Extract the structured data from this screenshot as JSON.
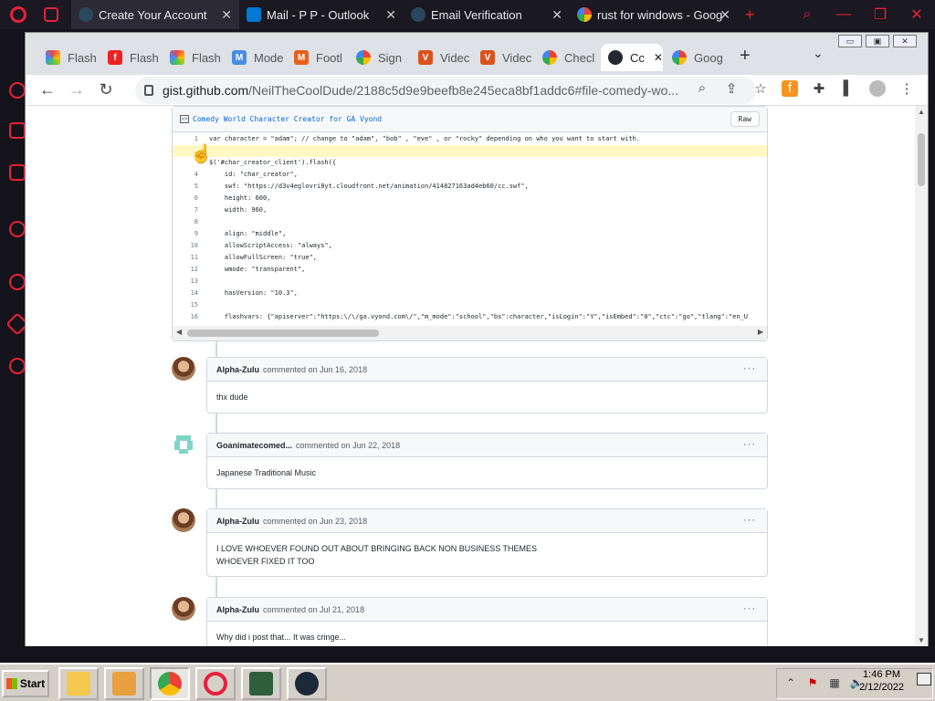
{
  "opera": {
    "tabs": [
      {
        "label": "Create Your Account",
        "active": true,
        "icon": "steam-icon"
      },
      {
        "label": "Mail - P P - Outlook",
        "active": false,
        "icon": "outlook-icon"
      },
      {
        "label": "Email Verification",
        "active": false,
        "icon": "steam-icon"
      },
      {
        "label": "rust for windows - Goog",
        "active": false,
        "icon": "google-icon"
      }
    ],
    "new_tab": "+"
  },
  "chrome": {
    "tabs": [
      {
        "label": "Flash",
        "icon": "rainbow-flash-icon"
      },
      {
        "label": "Flash",
        "icon": "adobe-flash-icon"
      },
      {
        "label": "Flash",
        "icon": "rainbow-flash-icon"
      },
      {
        "label": "Mode",
        "icon": "m-icon"
      },
      {
        "label": "Footl",
        "icon": "m-orange-icon"
      },
      {
        "label": "Sign",
        "icon": "google-icon"
      },
      {
        "label": "Videc",
        "icon": "v-icon"
      },
      {
        "label": "Videc",
        "icon": "v-icon"
      },
      {
        "label": "Checl",
        "icon": "google-icon"
      },
      {
        "label": "Cc",
        "icon": "github-icon",
        "active": true
      },
      {
        "label": "Goog",
        "icon": "google-icon"
      }
    ],
    "new_tab": "+",
    "url_host": "gist.github.com",
    "url_path": "/NeilTheCoolDude/2188c5d9e9beefb8e245eca8bf1addc6#file-comedy-wo..."
  },
  "gist": {
    "filename": "Comedy World Character Creator for GA Vyond",
    "raw_label": "Raw",
    "lines": [
      {
        "n": "1",
        "text": "var character = \"adam\"; // change to \"adam\", \"bob\" , \"eve\" , or \"rocky\" depending on who you want to start with."
      },
      {
        "n": "",
        "text": ""
      },
      {
        "n": "",
        "text": "$('#char_creator_client').flash({"
      },
      {
        "n": "4",
        "text": "    id: \"char_creator\","
      },
      {
        "n": "5",
        "text": "    swf: \"https://d3v4eglovri8yt.cloudfront.net/animation/414827163ad4eb60/cc.swf\","
      },
      {
        "n": "6",
        "text": "    height: 600,"
      },
      {
        "n": "7",
        "text": "    width: 960,"
      },
      {
        "n": "8",
        "text": ""
      },
      {
        "n": "9",
        "text": "    align: \"middle\","
      },
      {
        "n": "10",
        "text": "    allowScriptAccess: \"always\","
      },
      {
        "n": "11",
        "text": "    allowFullScreen: \"true\","
      },
      {
        "n": "12",
        "text": "    wmode: \"transparent\","
      },
      {
        "n": "13",
        "text": ""
      },
      {
        "n": "14",
        "text": "    hasVersion: \"10.3\","
      },
      {
        "n": "15",
        "text": ""
      },
      {
        "n": "16",
        "text": "    flashvars: {\"apiserver\":\"https:\\/\\/ga.vyond.com\\/\",\"m_mode\":\"school\",\"bs\":character,\"isLogin\":\"Y\",\"isEmbed\":\"0\",\"ctc\":\"go\",\"tlang\":\"en_U"
      }
    ]
  },
  "comments": [
    {
      "author": "Alpha-Zulu",
      "meta": "commented on Jun 16, 2018",
      "body": [
        "thx dude"
      ],
      "avatar": "photo"
    },
    {
      "author": "Goanimatecomed...",
      "meta": "commented on Jun 22, 2018",
      "body": [
        "Japanese Traditional Music"
      ],
      "avatar": "identicon"
    },
    {
      "author": "Alpha-Zulu",
      "meta": "commented on Jun 23, 2018",
      "body": [
        "I LOVE WHOEVER FOUND OUT ABOUT BRINGING BACK NON BUSINESS THEMES",
        "WHOEVER FIXED IT TOO"
      ],
      "avatar": "photo"
    },
    {
      "author": "Alpha-Zulu",
      "meta": "commented on Jul 21, 2018",
      "body": [
        "Why did i post that... It was cringe..."
      ],
      "avatar": "photo"
    }
  ],
  "taskbar": {
    "start_label": "Start",
    "time": "1:46 PM",
    "date": "2/12/2022"
  },
  "colors": {
    "opera_red": "#e8203a",
    "link_blue": "#0969da"
  }
}
